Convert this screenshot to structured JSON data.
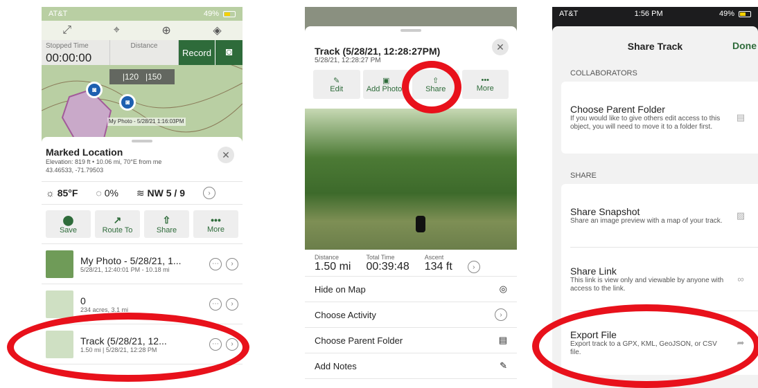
{
  "status": {
    "carrier": "AT&T",
    "time": "1:56 PM",
    "battery": "49%"
  },
  "p1": {
    "stats": [
      {
        "label": "Stopped Time",
        "value": "00:00:00"
      },
      {
        "label": "Distance",
        "value": ""
      }
    ],
    "record": "Record",
    "scale": [
      "|120",
      "|150"
    ],
    "photo_label": "My Photo - 5/28/21 1:16:03PM",
    "location": {
      "title": "Marked Location",
      "line1": "Elevation: 819 ft • 10.06 mi, 70°E from me",
      "line2": "43.46533, -71.79503"
    },
    "weather": {
      "temp": "85°F",
      "precip": "0%",
      "wind": "NW 5 / 9"
    },
    "actions": [
      {
        "icon": "map-pin-icon",
        "glyph": "⬤",
        "label": "Save"
      },
      {
        "icon": "route-icon",
        "glyph": "↗",
        "label": "Route To"
      },
      {
        "icon": "share-icon",
        "glyph": "⇧",
        "label": "Share"
      },
      {
        "icon": "more-icon",
        "glyph": "•••",
        "label": "More"
      }
    ],
    "rows": [
      {
        "title": "My Photo - 5/28/21, 1...",
        "sub": "5/28/21, 12:40:01 PM - 10.18 mi"
      },
      {
        "title": "0",
        "sub": "234 acres, 3.1 mi"
      },
      {
        "title": "Track (5/28/21, 12...",
        "sub": "1.50 mi | 5/28/21, 12:28 PM"
      }
    ]
  },
  "p2": {
    "title": "Track (5/28/21, 12:28:27PM)",
    "subtitle": "5/28/21, 12:28:27 PM",
    "actions": [
      {
        "icon": "edit-icon",
        "glyph": "✎",
        "label": "Edit"
      },
      {
        "icon": "photo-icon",
        "glyph": "▣",
        "label": "Add Photos"
      },
      {
        "icon": "share-icon",
        "glyph": "⇧",
        "label": "Share"
      },
      {
        "icon": "more-icon",
        "glyph": "•••",
        "label": "More"
      }
    ],
    "stats": [
      {
        "label": "Distance",
        "value": "1.50 mi"
      },
      {
        "label": "Total Time",
        "value": "00:39:48"
      },
      {
        "label": "Ascent",
        "value": "134 ft"
      }
    ],
    "items": [
      {
        "label": "Hide on Map",
        "glyph": "◎"
      },
      {
        "label": "Choose Activity",
        "glyph": "›"
      },
      {
        "label": "Choose Parent Folder",
        "glyph": "▤"
      },
      {
        "label": "Add Notes",
        "glyph": "✎"
      }
    ]
  },
  "p3": {
    "title": "Share Track",
    "done": "Done",
    "collab_header": "COLLABORATORS",
    "collab": {
      "title": "Choose Parent Folder",
      "desc": "If you would like to give others edit access to this object, you will need to move it to a folder first.",
      "glyph": "▤"
    },
    "share_header": "SHARE",
    "share": [
      {
        "title": "Share Snapshot",
        "desc": "Share an image preview with a map of your track.",
        "glyph": "▨"
      },
      {
        "title": "Share Link",
        "desc": "This link is view only and viewable by anyone with access to the link.",
        "glyph": "∞"
      },
      {
        "title": "Export File",
        "desc": "Export track to a GPX, KML, GeoJSON, or CSV file.",
        "glyph": "➦"
      }
    ]
  },
  "colors": {
    "accent": "#2e6b3a",
    "annotation": "#e8111b"
  }
}
